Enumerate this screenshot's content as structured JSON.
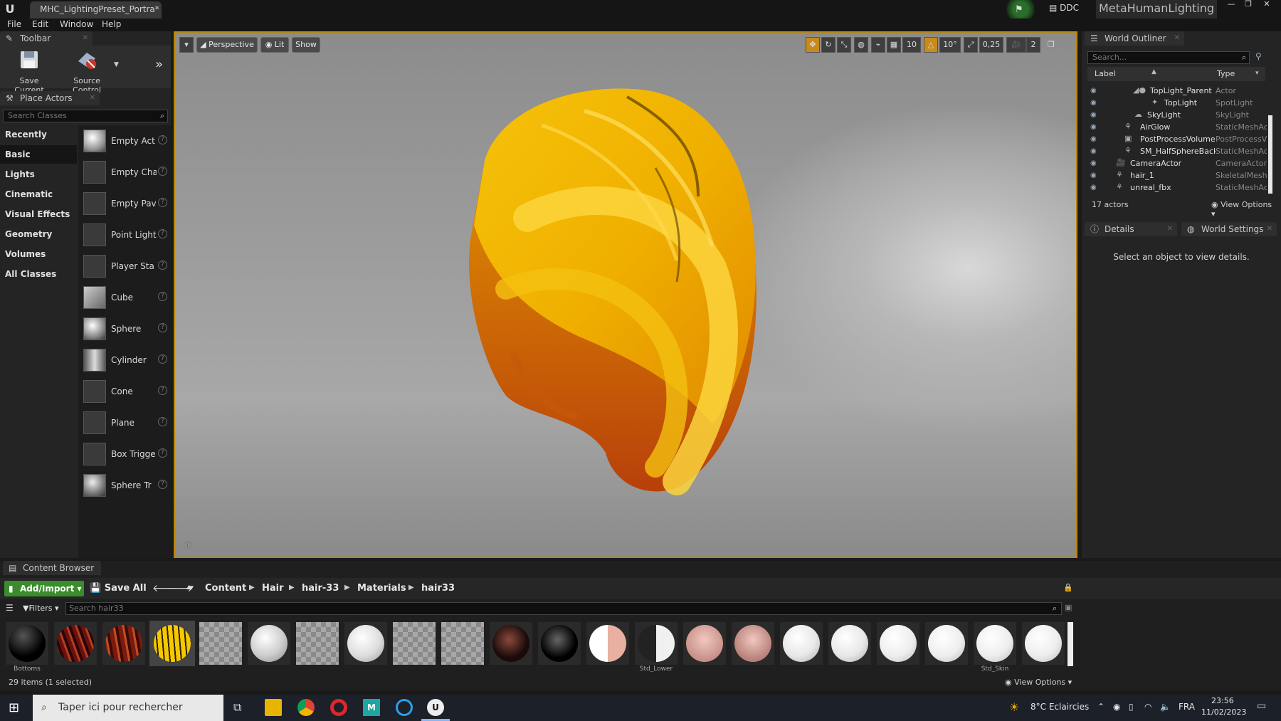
{
  "title_bar": {
    "doc_tab": "MHC_LightingPreset_Portra*",
    "ddc_label": "DDC",
    "project_name": "MetaHumanLighting"
  },
  "menu": [
    "File",
    "Edit",
    "Window",
    "Help"
  ],
  "toolbar": {
    "tab_label": "Toolbar",
    "save_current": "Save Current",
    "source_control": "Source Control"
  },
  "place_actors": {
    "tab_label": "Place Actors",
    "search_placeholder": "Search Classes",
    "categories": [
      "Recently Placed",
      "Basic",
      "Lights",
      "Cinematic",
      "Visual Effects",
      "Geometry",
      "Volumes",
      "All Classes"
    ],
    "active_category": "Basic",
    "actors": [
      "Empty Act",
      "Empty Cha",
      "Empty Pav",
      "Point Light",
      "Player Sta",
      "Cube",
      "Sphere",
      "Cylinder",
      "Cone",
      "Plane",
      "Box Trigge",
      "Sphere Tr"
    ]
  },
  "viewport": {
    "perspective": "Perspective",
    "lit": "Lit",
    "show": "Show",
    "grid_snap": "10",
    "rot_snap": "10°",
    "scale_snap": "0,25",
    "cam_speed": "2"
  },
  "world_outliner": {
    "tab_label": "World Outliner",
    "search_placeholder": "Search...",
    "col_label": "Label",
    "col_type": "Type",
    "rows": [
      {
        "name": "TopLight_Parent",
        "type": "Actor"
      },
      {
        "name": "TopLight",
        "type": "SpotLight"
      },
      {
        "name": "SkyLight",
        "type": "SkyLight"
      },
      {
        "name": "AirGlow",
        "type": "StaticMeshAc"
      },
      {
        "name": "PostProcessVolume",
        "type": "PostProcessV"
      },
      {
        "name": "SM_HalfSphereBackg",
        "type": "StaticMeshAc"
      },
      {
        "name": "CameraActor",
        "type": "CameraActor"
      },
      {
        "name": "hair_1",
        "type": "SkeletalMesh"
      },
      {
        "name": "unreal_fbx",
        "type": "StaticMeshAc"
      }
    ],
    "actor_count": "17 actors",
    "view_options": "View Options"
  },
  "details": {
    "tab_label": "Details",
    "world_settings": "World Settings",
    "empty_text": "Select an object to view details."
  },
  "content_browser": {
    "tab_label": "Content Browser",
    "add_import": "Add/Import",
    "save_all": "Save All",
    "breadcrumbs": [
      "Content",
      "Hair",
      "hair-33",
      "Materials",
      "hair33"
    ],
    "filters": "Filters",
    "search_placeholder": "Search hair33",
    "asset_labels": [
      "Bottoms",
      "",
      "",
      "",
      "",
      "",
      "",
      "",
      "",
      "",
      "",
      "",
      "",
      "Std_Lower",
      "",
      "",
      "",
      "",
      "",
      "",
      "Std_Skin",
      ""
    ],
    "status": "29 items (1 selected)",
    "view_options": "View Options"
  },
  "taskbar": {
    "search_placeholder": "Taper ici pour rechercher",
    "weather": "8°C  Eclaircies",
    "lang": "FRA",
    "time": "23:56",
    "date": "11/02/2023"
  }
}
